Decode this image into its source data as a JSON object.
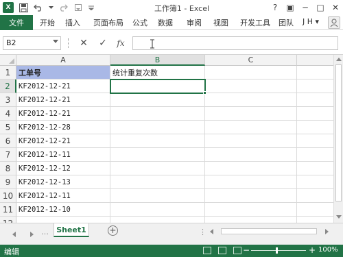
{
  "window": {
    "title": "工作簿1 - Excel",
    "controls": [
      "?",
      "▣",
      "─",
      "□",
      "✕"
    ]
  },
  "ribbon": {
    "file_tab": "文件",
    "tabs": [
      "开始",
      "插入",
      "页面布局",
      "公式",
      "数据",
      "审阅",
      "视图",
      "开发工具",
      "团队"
    ],
    "user": "J H ▾"
  },
  "formula_bar": {
    "name_box": "B2",
    "cancel_symbol": "✕",
    "enter_symbol": "✓",
    "fx_symbol": "fx",
    "formula": ""
  },
  "columns": [
    "A",
    "B",
    "C"
  ],
  "selected_column": "B",
  "rows": [
    "1",
    "2",
    "3",
    "4",
    "5",
    "6",
    "7",
    "8",
    "9",
    "10",
    "11",
    "12"
  ],
  "selected_row": "2",
  "cells": {
    "A1": "工单号",
    "B1": "统计重复次数",
    "A2": "KF2012-12-21",
    "A3": "KF2012-12-21",
    "A4": "KF2012-12-21",
    "A5": "KF2012-12-28",
    "A6": "KF2012-12-21",
    "A7": "KF2012-12-11",
    "A8": "KF2012-12-12",
    "A9": "KF2012-12-13",
    "A10": "KF2012-12-11",
    "A11": "KF2012-12-10"
  },
  "active_cell": "B2",
  "header_fill_color": "#a9b8e6",
  "accent_color": "#217346",
  "sheet_tabs": [
    "Sheet1"
  ],
  "add_sheet_symbol": "+",
  "status": {
    "mode": "编辑",
    "zoom_minus": "−",
    "zoom_plus": "+",
    "zoom": "100%"
  }
}
